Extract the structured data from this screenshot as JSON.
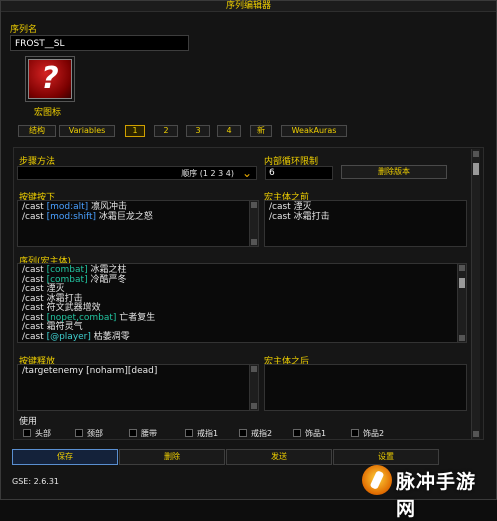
{
  "window": {
    "title": "序列编辑器"
  },
  "sequence_name": {
    "label": "序列名",
    "value": "FROST__SL"
  },
  "macro_icon": {
    "label": "宏图标",
    "glyph": "?"
  },
  "tabs": [
    {
      "label": "结构"
    },
    {
      "label": "Variables"
    },
    {
      "label": "1",
      "active": true
    },
    {
      "label": "2"
    },
    {
      "label": "3"
    },
    {
      "label": "4"
    },
    {
      "label": "新"
    },
    {
      "label": "WeakAuras"
    }
  ],
  "step_function": {
    "label": "步骤方法",
    "value": "顺序 (1 2 3 4)"
  },
  "inner_loop": {
    "label": "内部循环限制",
    "value": "6"
  },
  "delete_version_button": "删除版本",
  "keypress": {
    "label": "按键按下",
    "lines": [
      {
        "parts": [
          {
            "t": "/cast ",
            "c": "white"
          },
          {
            "t": "[mod:alt]",
            "c": "blue"
          },
          {
            "t": " 凛风冲击",
            "c": "white"
          }
        ]
      },
      {
        "parts": [
          {
            "t": "/cast ",
            "c": "white"
          },
          {
            "t": "[mod:shift]",
            "c": "blue"
          },
          {
            "t": " 冰霜巨龙之怒",
            "c": "white"
          }
        ]
      }
    ]
  },
  "premacro": {
    "label": "宏主体之前",
    "lines": [
      {
        "parts": [
          {
            "t": "/cast 湮灭",
            "c": "white"
          }
        ]
      },
      {
        "parts": [
          {
            "t": "/cast 冰霜打击",
            "c": "white"
          }
        ]
      }
    ]
  },
  "sequence": {
    "label": "序列(宏主体)",
    "lines": [
      {
        "parts": [
          {
            "t": "/cast ",
            "c": "white"
          },
          {
            "t": "[combat]",
            "c": "green"
          },
          {
            "t": " 冰霜之柱",
            "c": "white"
          }
        ]
      },
      {
        "parts": [
          {
            "t": "/cast ",
            "c": "white"
          },
          {
            "t": "[combat]",
            "c": "green"
          },
          {
            "t": " 冷酷严冬",
            "c": "white"
          }
        ]
      },
      {
        "parts": [
          {
            "t": "/cast 湮灭",
            "c": "white"
          }
        ]
      },
      {
        "parts": [
          {
            "t": "/cast 冰霜打击",
            "c": "white"
          }
        ]
      },
      {
        "parts": [
          {
            "t": "/cast 符文武器增效",
            "c": "white"
          }
        ]
      },
      {
        "parts": [
          {
            "t": "/cast ",
            "c": "white"
          },
          {
            "t": "[nopet,combat]",
            "c": "green"
          },
          {
            "t": " 亡者复生",
            "c": "white"
          }
        ]
      },
      {
        "parts": [
          {
            "t": "/cast 霜符灵气",
            "c": "white"
          }
        ]
      },
      {
        "parts": [
          {
            "t": "/cast ",
            "c": "white"
          },
          {
            "t": "[@player]",
            "c": "cyan"
          },
          {
            "t": " 枯萎凋零",
            "c": "white"
          }
        ]
      }
    ]
  },
  "keyrelease": {
    "label": "按键释放",
    "lines": [
      {
        "parts": [
          {
            "t": "/targetenemy ",
            "c": "white"
          },
          {
            "t": "[noharm][dead]",
            "c": "white"
          }
        ]
      }
    ]
  },
  "postmacro": {
    "label": "宏主体之后",
    "lines": []
  },
  "use": {
    "label": "使用",
    "items": [
      "头部",
      "颈部",
      "腰带",
      "戒指1",
      "戒指2",
      "饰品1",
      "饰品2"
    ]
  },
  "bottom_buttons": {
    "save": "保存",
    "delete": "删除",
    "send": "发送",
    "settings": "设置"
  },
  "status": "GSE: 2.6.31",
  "watermark": "脉冲手游网"
}
